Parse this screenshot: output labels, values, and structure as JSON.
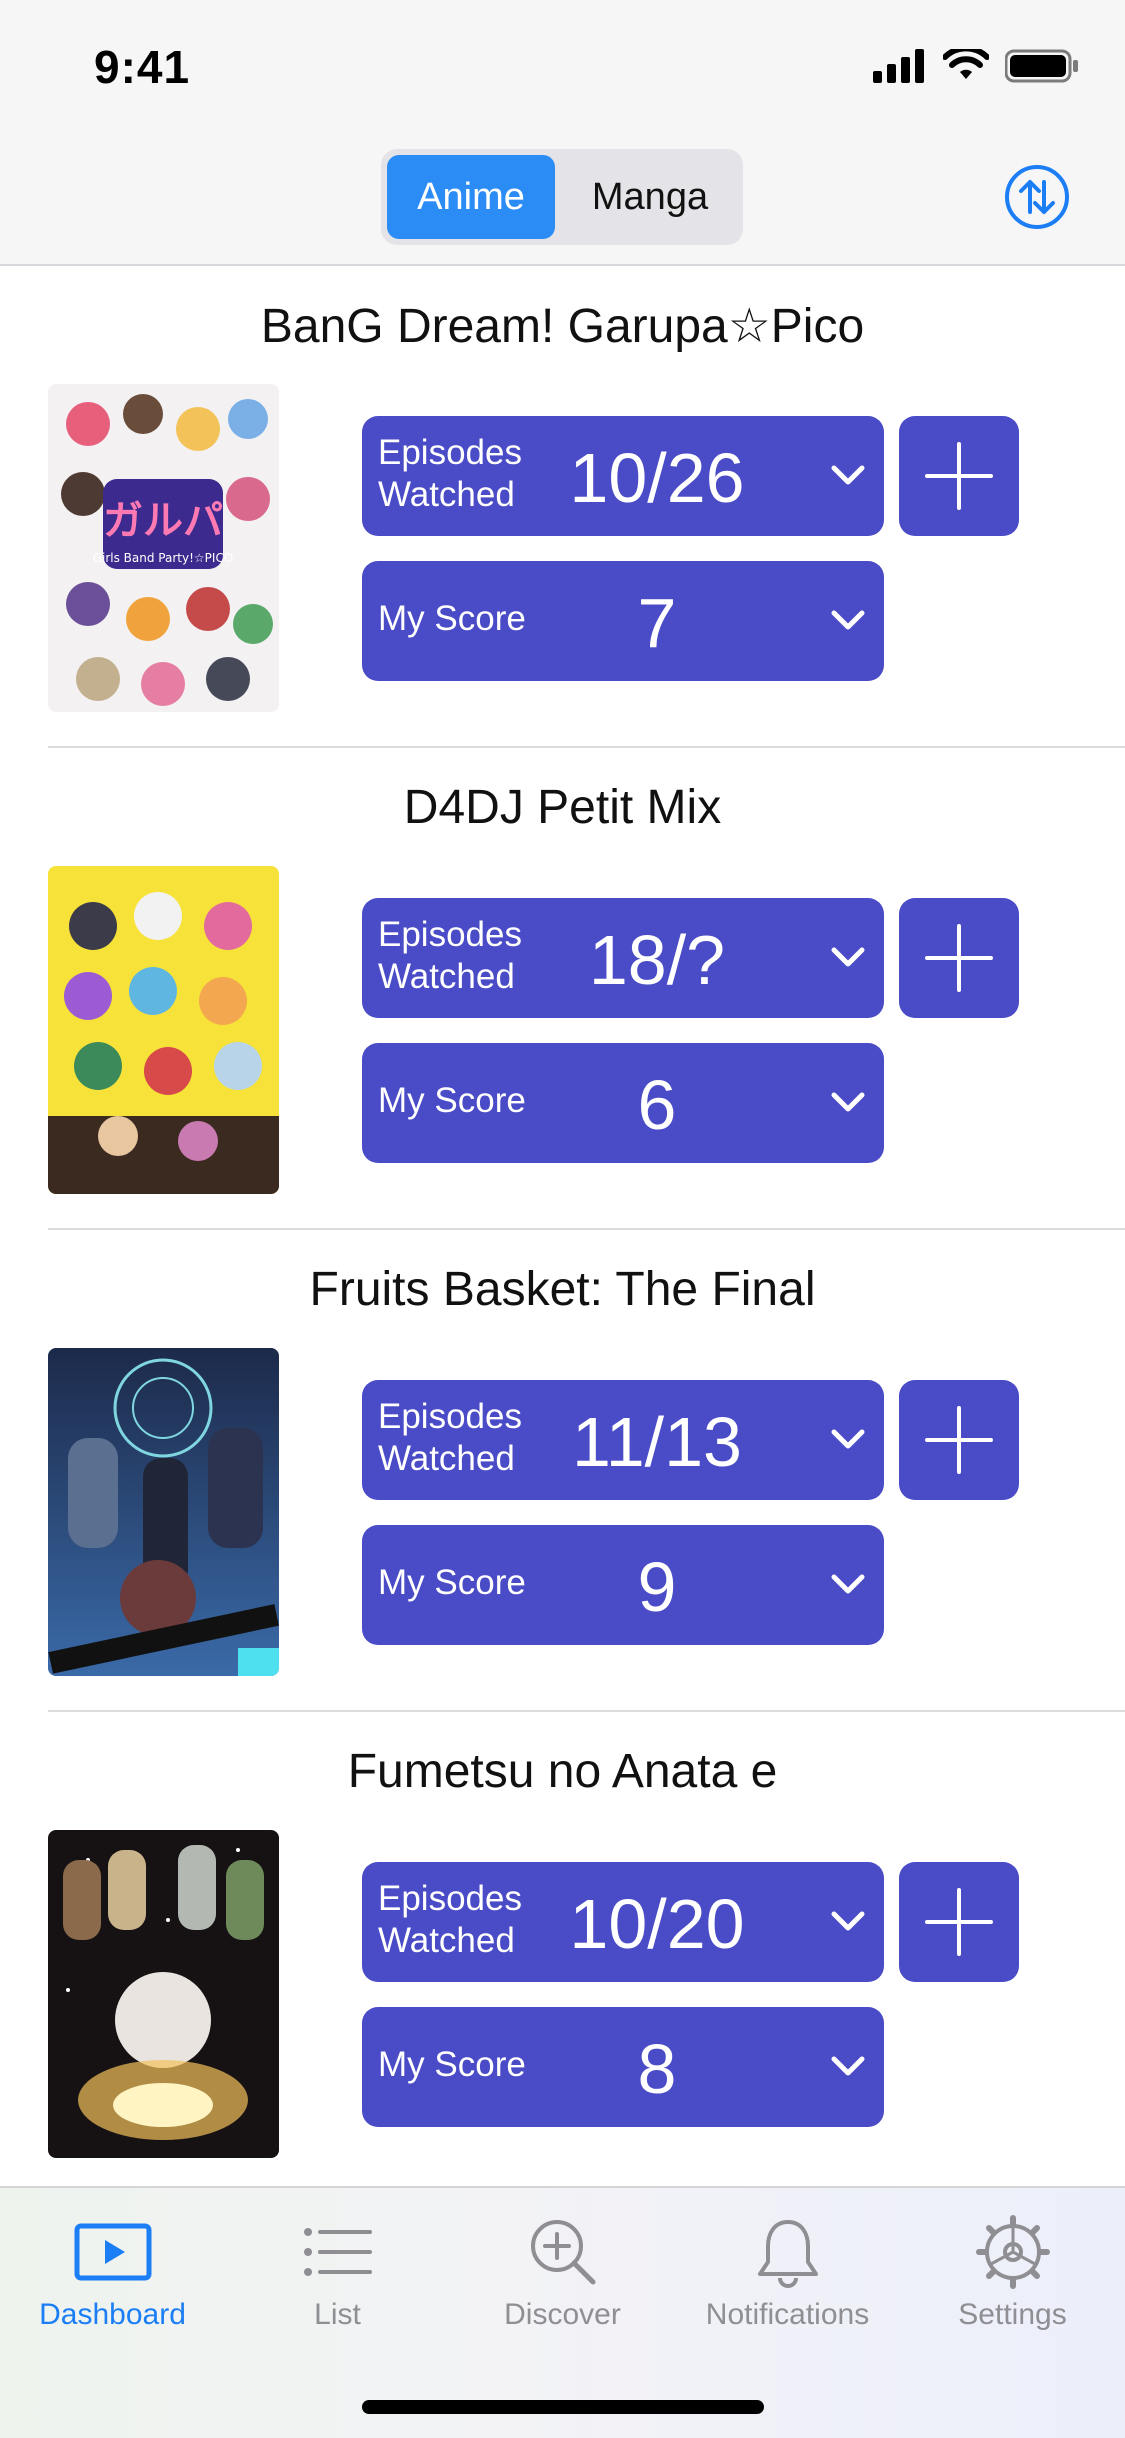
{
  "status_bar": {
    "time": "9:41"
  },
  "header": {
    "segments": [
      {
        "label": "Anime",
        "selected": true
      },
      {
        "label": "Manga",
        "selected": false
      }
    ],
    "sort_icon": "sort-arrows-icon"
  },
  "colors": {
    "accent": "#4a4bc6",
    "segment_active": "#2c8cf6",
    "tab_active": "#1b7ef5",
    "tab_inactive": "#8e8e93"
  },
  "items": [
    {
      "title": "BanG Dream! Garupa☆Pico",
      "episodes_label_1": "Episodes",
      "episodes_label_2": "Watched",
      "episodes": "10/26",
      "score_label": "My Score",
      "score": "7"
    },
    {
      "title": "D4DJ Petit Mix",
      "episodes_label_1": "Episodes",
      "episodes_label_2": "Watched",
      "episodes": "18/?",
      "score_label": "My Score",
      "score": "6"
    },
    {
      "title": "Fruits Basket: The Final",
      "episodes_label_1": "Episodes",
      "episodes_label_2": "Watched",
      "episodes": "11/13",
      "score_label": "My Score",
      "score": "9"
    },
    {
      "title": "Fumetsu no Anata e",
      "episodes_label_1": "Episodes",
      "episodes_label_2": "Watched",
      "episodes": "10/20",
      "score_label": "My Score",
      "score": "8"
    }
  ],
  "tabs": [
    {
      "label": "Dashboard",
      "icon": "play-rectangle-icon",
      "active": true
    },
    {
      "label": "List",
      "icon": "list-icon",
      "active": false
    },
    {
      "label": "Discover",
      "icon": "magnifier-plus-icon",
      "active": false
    },
    {
      "label": "Notifications",
      "icon": "bell-icon",
      "active": false
    },
    {
      "label": "Settings",
      "icon": "gear-icon",
      "active": false
    }
  ]
}
